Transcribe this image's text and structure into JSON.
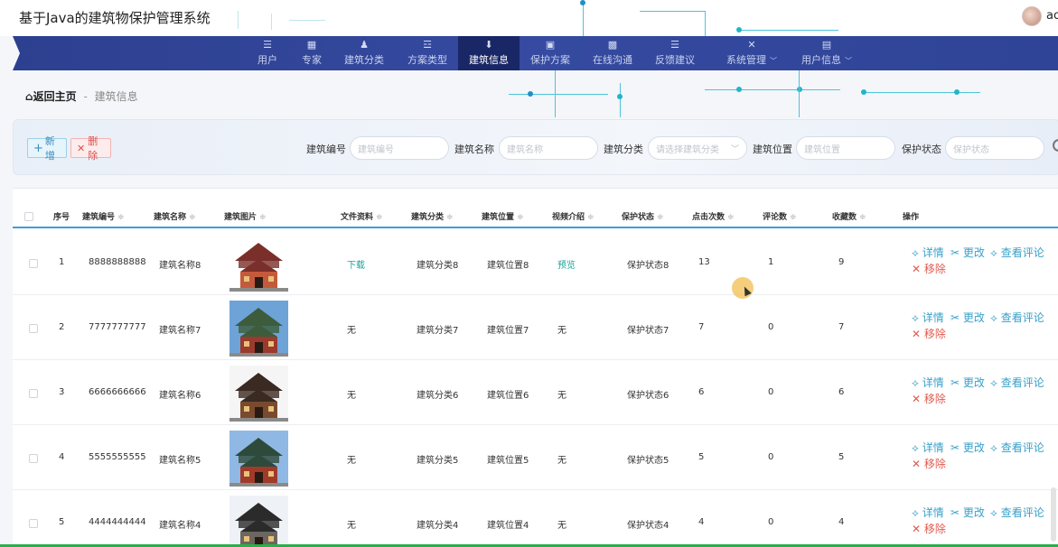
{
  "app": {
    "title": "基于Java的建筑物保护管理系统",
    "username": "ac"
  },
  "nav": [
    {
      "label": "用户",
      "icon": "☰",
      "name": "nav-users"
    },
    {
      "label": "专家",
      "icon": "▦",
      "name": "nav-experts"
    },
    {
      "label": "建筑分类",
      "icon": "♟",
      "name": "nav-building-category"
    },
    {
      "label": "方案类型",
      "icon": "☲",
      "name": "nav-plan-type"
    },
    {
      "label": "建筑信息",
      "icon": "⬇",
      "name": "nav-building-info",
      "active": true
    },
    {
      "label": "保护方案",
      "icon": "▣",
      "name": "nav-protection-plan"
    },
    {
      "label": "在线沟通",
      "icon": "▩",
      "name": "nav-online-chat"
    },
    {
      "label": "反馈建议",
      "icon": "☰",
      "name": "nav-feedback"
    },
    {
      "label": "系统管理",
      "icon": "✕",
      "name": "nav-system",
      "caret": "﹀"
    },
    {
      "label": "用户信息",
      "icon": "▤",
      "name": "nav-user-info",
      "caret": "﹀"
    }
  ],
  "breadcrumb": {
    "home": "返回主页",
    "separator": "-",
    "current": "建筑信息"
  },
  "toolbar": {
    "add_label": "新增",
    "delete_label": "删除"
  },
  "search": {
    "code": {
      "label": "建筑编号",
      "placeholder": "建筑编号"
    },
    "name": {
      "label": "建筑名称",
      "placeholder": "建筑名称"
    },
    "category": {
      "label": "建筑分类",
      "placeholder": "请选择建筑分类"
    },
    "location": {
      "label": "建筑位置",
      "placeholder": "建筑位置"
    },
    "status": {
      "label": "保护状态",
      "placeholder": "保护状态"
    }
  },
  "table": {
    "headers": {
      "index": "序号",
      "code": "建筑编号",
      "name": "建筑名称",
      "image": "建筑图片",
      "file": "文件资料",
      "category": "建筑分类",
      "location": "建筑位置",
      "video": "视频介绍",
      "status": "保护状态",
      "clicks": "点击次数",
      "comments": "评论数",
      "favorites": "收藏数",
      "actions": "操作"
    },
    "sort_icon": "≑",
    "ops": {
      "detail": "详情",
      "edit": "更改",
      "comments": "查看评论",
      "remove": "移除"
    },
    "rows": [
      {
        "index": "1",
        "code": "8888888888",
        "name": "建筑名称8",
        "file": "下载",
        "category": "建筑分类8",
        "location": "建筑位置8",
        "video": "预览",
        "status": "保护状态8",
        "clicks": "13",
        "comments": "1",
        "favorites": "9"
      },
      {
        "index": "2",
        "code": "7777777777",
        "name": "建筑名称7",
        "file": "无",
        "category": "建筑分类7",
        "location": "建筑位置7",
        "video": "无",
        "status": "保护状态7",
        "clicks": "7",
        "comments": "0",
        "favorites": "7"
      },
      {
        "index": "3",
        "code": "6666666666",
        "name": "建筑名称6",
        "file": "无",
        "category": "建筑分类6",
        "location": "建筑位置6",
        "video": "无",
        "status": "保护状态6",
        "clicks": "6",
        "comments": "0",
        "favorites": "6"
      },
      {
        "index": "4",
        "code": "5555555555",
        "name": "建筑名称5",
        "file": "无",
        "category": "建筑分类5",
        "location": "建筑位置5",
        "video": "无",
        "status": "保护状态5",
        "clicks": "5",
        "comments": "0",
        "favorites": "5"
      },
      {
        "index": "5",
        "code": "4444444444",
        "name": "建筑名称4",
        "file": "无",
        "category": "建筑分类4",
        "location": "建筑位置4",
        "video": "无",
        "status": "保护状态4",
        "clicks": "4",
        "comments": "0",
        "favorites": "4"
      }
    ]
  },
  "colors": {
    "nav_bg": "#354aa0",
    "nav_active": "#1a2766",
    "accent": "#3e9ed6",
    "link": "#1aa39a",
    "danger": "#e05a4f"
  }
}
